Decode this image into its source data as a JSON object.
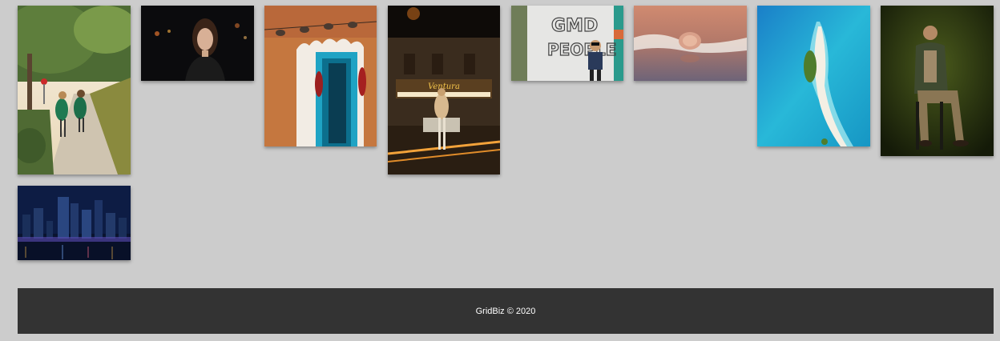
{
  "gallery": {
    "photos": [
      {
        "name": "photo-girls-walking-sidewalk",
        "alt": "Two girls in green dresses walking on a sidewalk"
      },
      {
        "name": "photo-woman-portrait-night",
        "alt": "Portrait of a woman at night"
      },
      {
        "name": "photo-adobe-blue-door",
        "alt": "Adobe wall with blue door and chili ristras"
      },
      {
        "name": "photo-ventura-theater-night",
        "alt": "Woman in front of Ventura theater at night"
      },
      {
        "name": "photo-boy-graffiti-wall",
        "alt": "Boy in mask in front of graffiti wall"
      },
      {
        "name": "photo-seashell-waves",
        "alt": "Seashell on the shore with waves"
      },
      {
        "name": "photo-island-aerial",
        "alt": "Aerial view of a sandbar island"
      },
      {
        "name": "photo-man-seated-portrait",
        "alt": "Man seated on stool, green backdrop"
      },
      {
        "name": "photo-city-skyline-night",
        "alt": "City skyline at night over water"
      }
    ]
  },
  "footer": {
    "text": "GridBiz © 2020"
  },
  "colors": {
    "background": "#cccccc",
    "footer_background": "#333333",
    "footer_text": "#ffffff"
  }
}
